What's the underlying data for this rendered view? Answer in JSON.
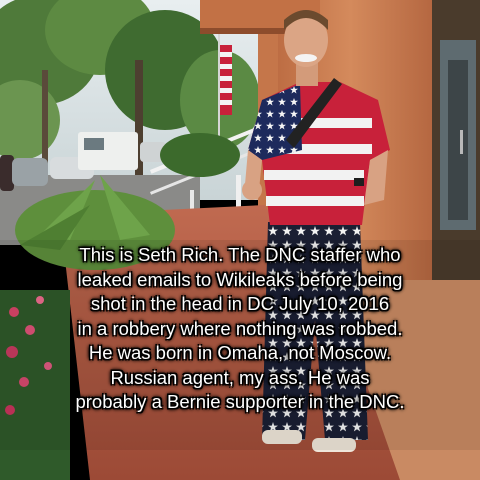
{
  "meme": {
    "caption_lines": [
      "This is Seth Rich. The DNC staffer who",
      "leaked emails to Wikileaks before being",
      "shot in the head in DC July 10, 2016",
      "in a robbery where nothing was robbed.",
      "He was born in Omaha, not Moscow.",
      "Russian agent, my ass. He was",
      "probably a Bernie supporter in the DNC."
    ],
    "colors": {
      "caption_text": "#ffffff",
      "caption_outline": "#000000",
      "shirt_red": "#c8213a",
      "shirt_blue": "#1d2a5c",
      "wall": "#c9794c",
      "brick": "#b5573f"
    }
  }
}
